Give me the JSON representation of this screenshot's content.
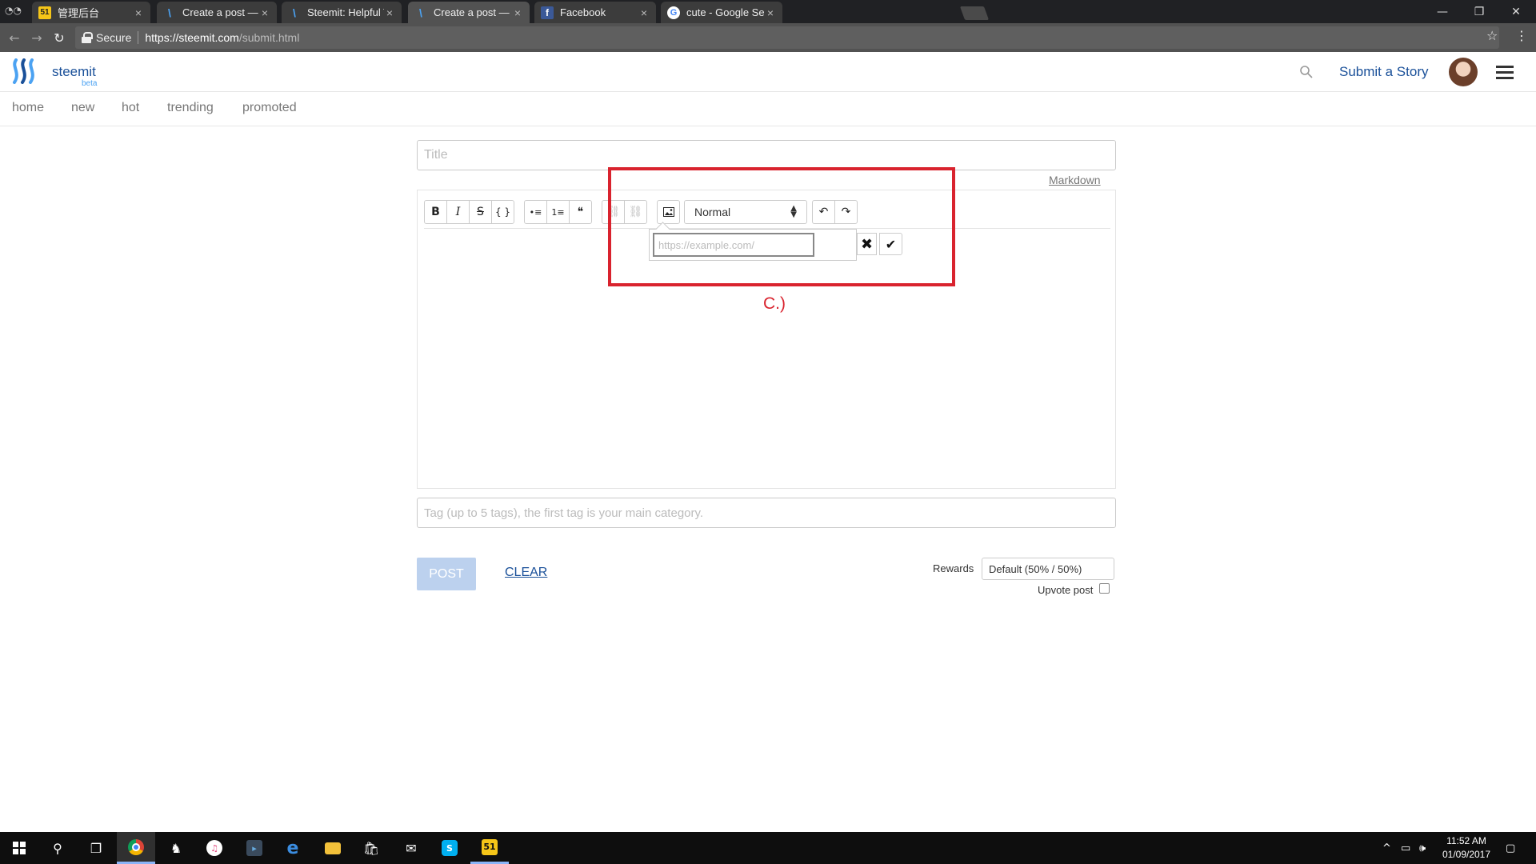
{
  "browser": {
    "tabs": [
      {
        "title": "管理后台",
        "favicon": "51-icon"
      },
      {
        "title": "Create a post — Steemit",
        "favicon": "steemit-icon"
      },
      {
        "title": "Steemit: Helpful Tags! —",
        "favicon": "steemit-icon"
      },
      {
        "title": "Create a post — Steemit",
        "favicon": "steemit-icon"
      },
      {
        "title": "Facebook",
        "favicon": "facebook-icon"
      },
      {
        "title": "cute - Google Search",
        "favicon": "google-icon"
      }
    ],
    "tab_close_glyph": "×",
    "secure_label": "Secure",
    "url_host": "https://steemit.com",
    "url_path": "/submit.html",
    "window_controls": {
      "minimize": "—",
      "restore": "❐",
      "close": "✕"
    }
  },
  "site": {
    "logo_text": "steemit",
    "logo_beta": "beta",
    "submit_story": "Submit a Story",
    "nav": [
      "home",
      "new",
      "hot",
      "trending",
      "promoted"
    ],
    "brand_color": "#1a5099"
  },
  "editor": {
    "title_placeholder": "Title",
    "markdown_link": "Markdown",
    "toolbar": {
      "format": [
        "B",
        "I",
        "S",
        "{ }"
      ],
      "lists": [
        "•≡",
        "1≡",
        "❝"
      ],
      "links": [
        "link-icon",
        "unlink-icon"
      ],
      "image": "image-icon",
      "block_style": "Normal",
      "history": [
        "↶",
        "↷"
      ]
    },
    "link_popup": {
      "placeholder": "https://example.com/",
      "cancel": "✖",
      "confirm": "✔"
    },
    "tags_placeholder": "Tag (up to 5 tags), the first tag is your main category.",
    "post_button": "POST",
    "clear_button": "CLEAR",
    "rewards_label": "Rewards",
    "rewards_value": "Default (50% / 50%)",
    "upvote_label": "Upvote post",
    "upvote_checked": false
  },
  "annotation": {
    "label": "C.)",
    "color": "#d9232e"
  },
  "taskbar": {
    "time": "11:52 AM",
    "date": "01/09/2017",
    "apps": [
      "windows-start-icon",
      "search-icon",
      "task-view-icon",
      "chrome-icon",
      "browser-icon",
      "itunes-icon",
      "app-icon",
      "edge-icon",
      "file-explorer-icon",
      "store-icon",
      "mail-icon",
      "skype-icon",
      "51-icon"
    ]
  }
}
